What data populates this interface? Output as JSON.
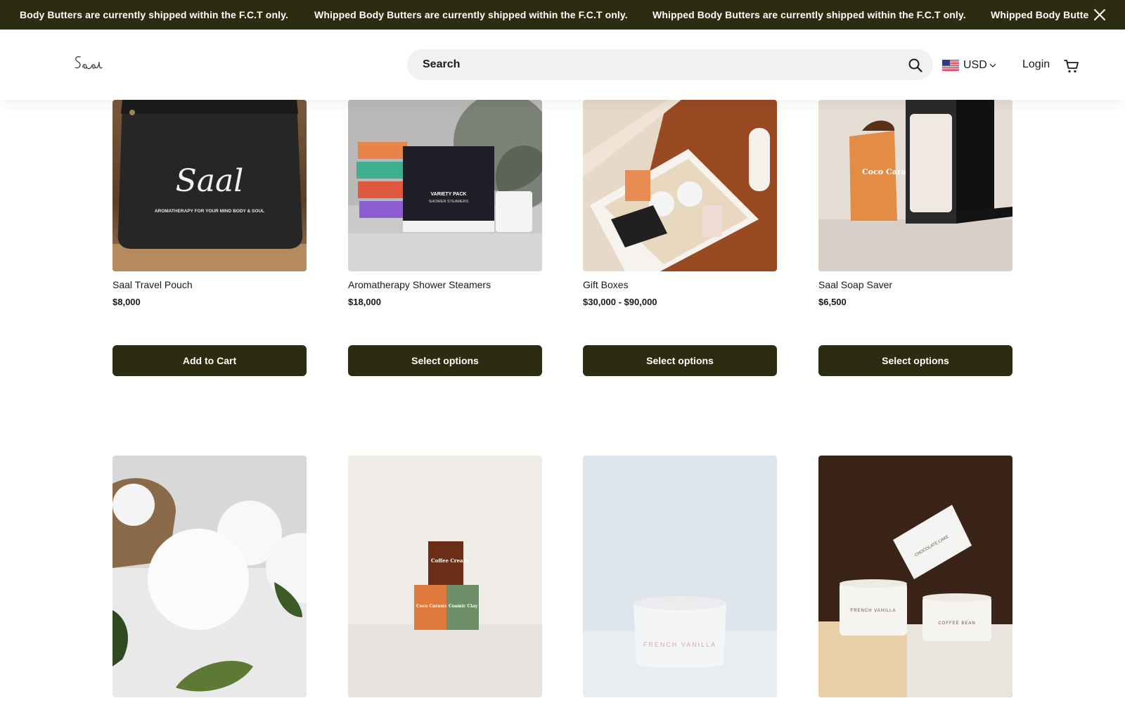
{
  "announcement": {
    "messages": [
      "Body Butters are currently shipped within the F.C.T only.",
      "Whipped Body Butters are currently shipped within the F.C.T only.",
      "Whipped Body Butters are currently shipped within the F.C.T only.",
      "Whipped Body Butte"
    ],
    "close_icon": "close-icon"
  },
  "header": {
    "logo_text": "Saal",
    "search_placeholder": "Search",
    "currency": "USD",
    "login_label": "Login",
    "cart_icon": "cart-icon"
  },
  "products_top": [
    {
      "name": "Saal Travel Pouch",
      "price": "$8,000",
      "button": "Add to Cart"
    },
    {
      "name": "Aromatherapy Shower Steamers",
      "price": "$18,000",
      "button": "Select options"
    },
    {
      "name": "Gift Boxes",
      "price": "$30,000 - $90,000",
      "button": "Select options"
    },
    {
      "name": "Saal Soap Saver",
      "price": "$6,500",
      "button": "Select options"
    }
  ],
  "image_text": {
    "pouch_brand": "Saal",
    "pouch_tagline": "AROMATHERAPY FOR YOUR MIND BODY & SOUL",
    "steamer_box": "VARIETY PACK",
    "steamer_box_sub": "SHOWER STEAMERS",
    "soap_saver_box": "Coco Caramel",
    "soap_top": "Coffee Cream",
    "soap_left": "Coco Caramel",
    "soap_right": "Cosmic Clay",
    "scrub_label": "FRENCH VANILLA",
    "butter_top": "CHOCOLATE CAKE",
    "butter_left": "FRENCH VANILLA",
    "butter_right": "COFFEE BEAN"
  },
  "colors": {
    "brand_dark": "#2c2d10",
    "background": "#ffffff",
    "search_bg": "#f1f1f1"
  }
}
